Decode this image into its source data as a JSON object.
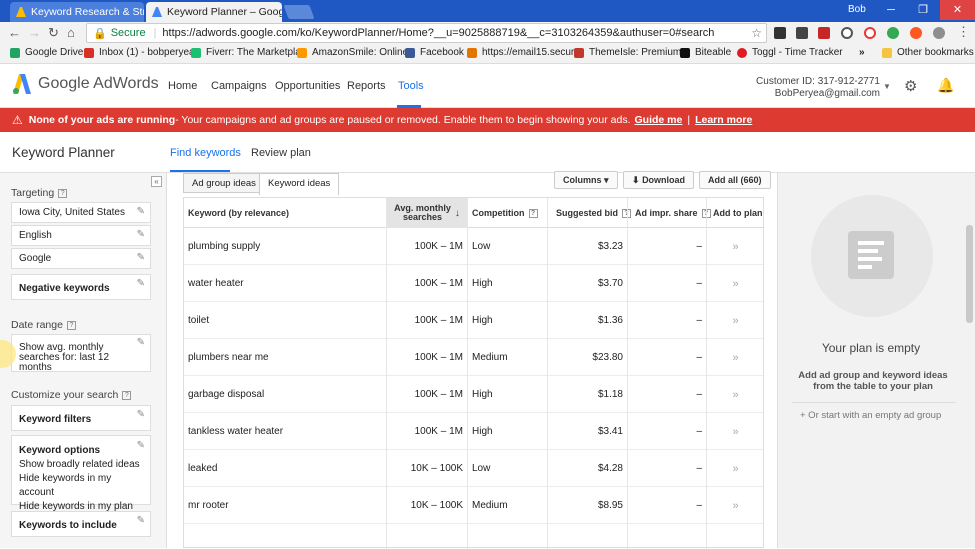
{
  "browser": {
    "tabs": [
      {
        "title": "Keyword Research & Stra",
        "active": false
      },
      {
        "title": "Keyword Planner – Goog",
        "active": true
      }
    ],
    "profile_name": "Bob",
    "url_secure": "Secure",
    "url": "https://adwords.google.com/ko/KeywordPlanner/Home?__u=9025888719&__c=3103264359&authuser=0#search",
    "bookmarks": [
      {
        "label": "Google Drive",
        "color": "#1fa463"
      },
      {
        "label": "Inbox (1) - bobperyea",
        "color": "#d93025"
      },
      {
        "label": "Fiverr: The Marketpla",
        "color": "#1dbf73"
      },
      {
        "label": "AmazonSmile: Online",
        "color": "#ff9900"
      },
      {
        "label": "Facebook",
        "color": "#3b5998"
      },
      {
        "label": "https://email15.secur",
        "color": "#e37400"
      },
      {
        "label": "ThemeIsle: Premium",
        "color": "#c0392b"
      },
      {
        "label": "Biteable",
        "color": "#111111"
      },
      {
        "label": "Toggl - Time Tracker",
        "color": "#e01b22"
      }
    ],
    "more_bookmarks": "»",
    "other_bookmarks": "Other bookmarks"
  },
  "header": {
    "logo": "Google AdWords",
    "nav": [
      "Home",
      "Campaigns",
      "Opportunities",
      "Reports",
      "Tools"
    ],
    "active_nav": "Tools",
    "customer_id": "Customer ID: 317-912-2771",
    "email": "BobPeryea@gmail.com"
  },
  "alert": {
    "bold": "None of your ads are running",
    "text": " - Your campaigns and ad groups are paused or removed. Enable them to begin showing your ads.",
    "link1": "Guide me",
    "sep": "|",
    "link2": "Learn more"
  },
  "page": {
    "title": "Keyword Planner",
    "tabs": [
      "Find keywords",
      "Review plan"
    ]
  },
  "sidebar": {
    "targeting_label": "Targeting",
    "targeting": [
      "Iowa City, United States",
      "English",
      "Google",
      "Negative keywords"
    ],
    "date_label": "Date range",
    "date_value": "Show avg. monthly searches for: last 12 months",
    "customize_label": "Customize your search",
    "keyword_filters": "Keyword filters",
    "keyword_options_title": "Keyword options",
    "keyword_options": [
      "Show broadly related ideas",
      "Hide keywords in my account",
      "Hide keywords in my plan"
    ],
    "keywords_to_include": "Keywords to include",
    "collapse": "«"
  },
  "results": {
    "subtabs": [
      "Ad group ideas",
      "Keyword ideas"
    ],
    "active_subtab": "Keyword ideas",
    "columns_btn": "Columns ▾",
    "download_btn": "Download",
    "add_all_btn": "Add all (660)",
    "headers": {
      "keyword": "Keyword (by relevance)",
      "avg_line1": "Avg. monthly",
      "avg_line2": "searches",
      "competition": "Competition",
      "bid": "Suggested bid",
      "impr": "Ad impr. share",
      "add": "Add to plan"
    },
    "rows": [
      {
        "keyword": "plumbing supply",
        "avg": "100K – 1M",
        "competition": "Low",
        "bid": "$3.23",
        "impr": "–",
        "add": "»"
      },
      {
        "keyword": "water heater",
        "avg": "100K – 1M",
        "competition": "High",
        "bid": "$3.70",
        "impr": "–",
        "add": "»"
      },
      {
        "keyword": "toilet",
        "avg": "100K – 1M",
        "competition": "High",
        "bid": "$1.36",
        "impr": "–",
        "add": "»"
      },
      {
        "keyword": "plumbers near me",
        "avg": "100K – 1M",
        "competition": "Medium",
        "bid": "$23.80",
        "impr": "–",
        "add": "»"
      },
      {
        "keyword": "garbage disposal",
        "avg": "100K – 1M",
        "competition": "High",
        "bid": "$1.18",
        "impr": "–",
        "add": "»"
      },
      {
        "keyword": "tankless water heater",
        "avg": "100K – 1M",
        "competition": "High",
        "bid": "$3.41",
        "impr": "–",
        "add": "»"
      },
      {
        "keyword": "leaked",
        "avg": "10K – 100K",
        "competition": "Low",
        "bid": "$4.28",
        "impr": "–",
        "add": "»"
      },
      {
        "keyword": "mr rooter",
        "avg": "10K – 100K",
        "competition": "Medium",
        "bid": "$8.95",
        "impr": "–",
        "add": "»"
      }
    ]
  },
  "plan": {
    "title": "Your plan is empty",
    "desc": "Add ad group and keyword ideas from the table to your plan",
    "empty_link": "+ Or start with an empty ad group"
  }
}
